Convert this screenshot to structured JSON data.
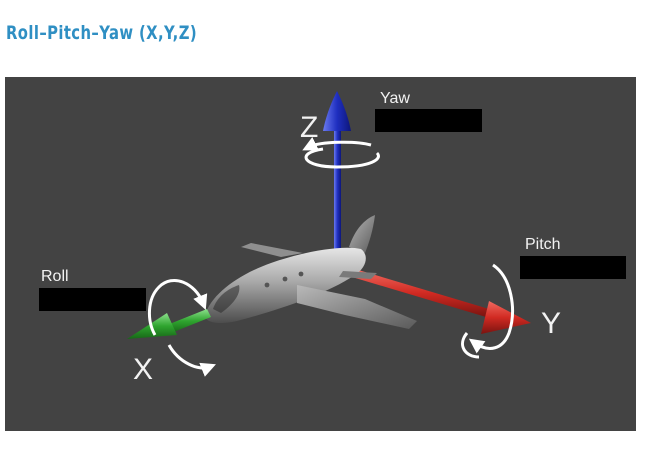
{
  "title": "Roll–Pitch–Yaw (X,Y,Z)",
  "axes": {
    "x_letter": "X",
    "y_letter": "Y",
    "z_letter": "Z"
  },
  "labels": {
    "yaw": "Yaw",
    "pitch": "Pitch",
    "roll": "Roll"
  },
  "colors": {
    "title": "#2f8fc3",
    "panel_background": "#434343",
    "x_axis": "#2fa52f",
    "y_axis": "#d12a22",
    "z_axis": "#1f2fc0",
    "rotation_arrows": "#ffffff",
    "redaction": "#000000"
  },
  "icons": {
    "aircraft": "jet-airplane-model",
    "rotation_marker": "curved-rotation-arrow"
  }
}
